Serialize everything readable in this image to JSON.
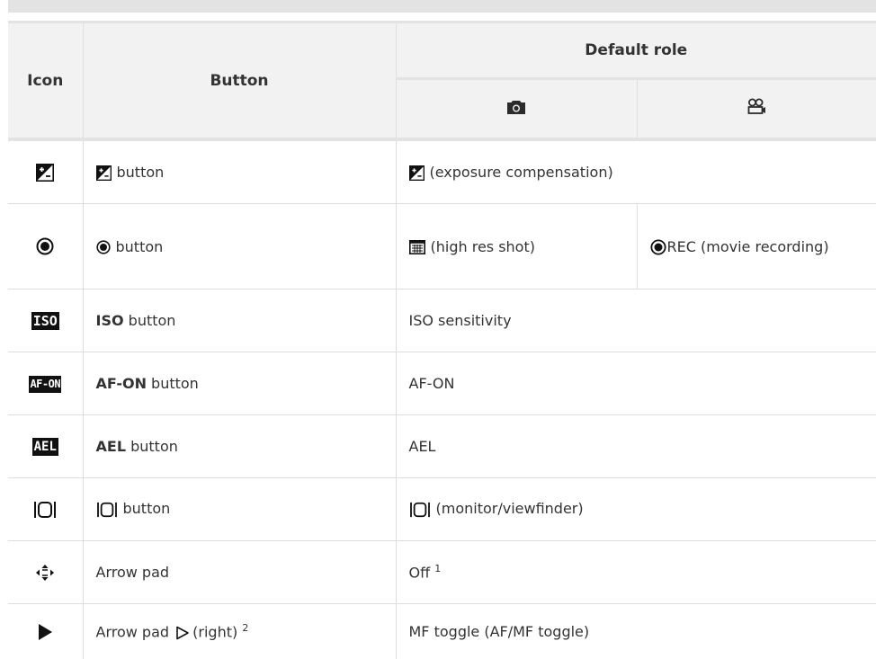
{
  "header": {
    "icon": "Icon",
    "button": "Button",
    "default_role": "Default role",
    "photo_col_icon": "camera-icon",
    "movie_col_icon": "movie-camera-icon"
  },
  "rows": [
    {
      "icon": "exposure-compensation-icon",
      "button_label": "button",
      "role": "(exposure compensation)"
    },
    {
      "icon": "record-icon",
      "button_label": "button",
      "role_photo": "(high res shot)",
      "role_movie_prefix": "REC",
      "role_movie": "(movie recording)"
    },
    {
      "icon": "iso-icon",
      "icon_text": "ISO",
      "button_bold": "ISO",
      "button_label": "button",
      "role": "ISO sensitivity"
    },
    {
      "icon": "af-on-icon",
      "icon_text": "AF-ON",
      "button_bold": "AF-ON",
      "button_label": "button",
      "role": "AF-ON"
    },
    {
      "icon": "ael-icon",
      "icon_text": "AEL",
      "button_bold": "AEL",
      "button_label": "button",
      "role": "AEL"
    },
    {
      "icon": "monitor-viewfinder-icon",
      "button_label": "button",
      "role": "(monitor/viewfinder)"
    },
    {
      "icon": "arrow-pad-icon",
      "button_label": "Arrow pad",
      "role": "Off",
      "role_sup": "1"
    },
    {
      "icon": "play-icon",
      "button_label": "Arrow pad",
      "button_suffix": "(right)",
      "button_sup": "2",
      "role": "MF toggle (AF/MF toggle)"
    }
  ]
}
